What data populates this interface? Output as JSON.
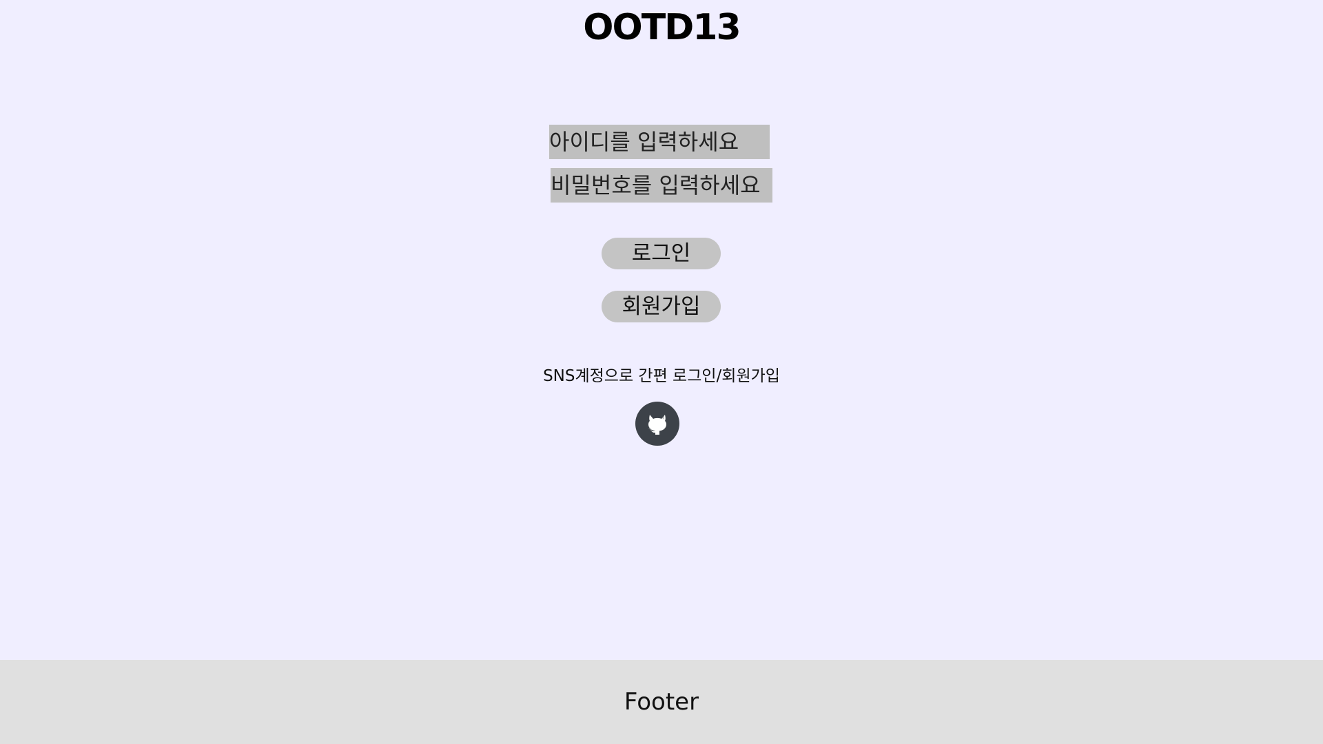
{
  "header": {
    "logo_text": "OOTD13"
  },
  "login_form": {
    "id_placeholder": "아이디를 입력하세요",
    "password_placeholder": "비밀번호를 입력하세요",
    "login_label": "로그인",
    "signup_label": "회원가입"
  },
  "sns": {
    "text": "SNS계정으로 간편 로그인/회원가입",
    "providers": [
      {
        "icon": "github-icon"
      }
    ]
  },
  "footer": {
    "text": "Footer"
  },
  "colors": {
    "background": "#f0eeff",
    "input_bg": "#bfbfbf",
    "button_bg": "#c4c4c4",
    "github_bg": "#3d4249",
    "footer_bg": "#e0e0e0"
  }
}
